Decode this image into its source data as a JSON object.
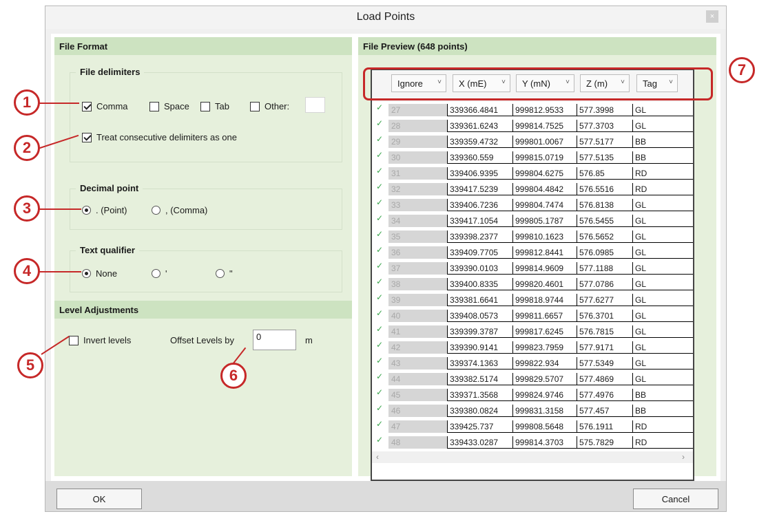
{
  "dialog": {
    "title": "Load Points",
    "close_glyph": "×"
  },
  "file_format": {
    "header": "File Format",
    "delimiters": {
      "label": "File delimiters",
      "comma": {
        "label": "Comma",
        "checked": true
      },
      "space": {
        "label": "Space",
        "checked": false
      },
      "tab": {
        "label": "Tab",
        "checked": false
      },
      "other": {
        "label": "Other:",
        "checked": false,
        "value": ""
      },
      "consecutive": {
        "label": "Treat consecutive delimiters as one",
        "checked": true
      }
    },
    "decimal": {
      "label": "Decimal point",
      "point": {
        "label": ". (Point)",
        "selected": true
      },
      "comma": {
        "label": ", (Comma)",
        "selected": false
      }
    },
    "qualifier": {
      "label": "Text qualifier",
      "none": {
        "label": "None",
        "selected": true
      },
      "single": {
        "label": "'",
        "selected": false
      },
      "double": {
        "label": "\"",
        "selected": false
      }
    }
  },
  "level_adjustments": {
    "header": "Level Adjustments",
    "invert": {
      "label": "Invert levels",
      "checked": false
    },
    "offset": {
      "label": "Offset Levels by",
      "value": "0",
      "unit": "m"
    }
  },
  "preview": {
    "header": "File Preview  (648 points)",
    "columns": [
      "Ignore",
      "X (mE)",
      "Y (mN)",
      "Z (m)",
      "Tag"
    ],
    "rows": [
      [
        "27",
        "339366.4841",
        "999812.9533",
        "577.3998",
        "GL"
      ],
      [
        "28",
        "339361.6243",
        "999814.7525",
        "577.3703",
        "GL"
      ],
      [
        "29",
        "339359.4732",
        "999801.0067",
        "577.5177",
        "BB"
      ],
      [
        "30",
        "339360.559",
        "999815.0719",
        "577.5135",
        "BB"
      ],
      [
        "31",
        "339406.9395",
        "999804.6275",
        "576.85",
        "RD"
      ],
      [
        "32",
        "339417.5239",
        "999804.4842",
        "576.5516",
        "RD"
      ],
      [
        "33",
        "339406.7236",
        "999804.7474",
        "576.8138",
        "GL"
      ],
      [
        "34",
        "339417.1054",
        "999805.1787",
        "576.5455",
        "GL"
      ],
      [
        "35",
        "339398.2377",
        "999810.1623",
        "576.5652",
        "GL"
      ],
      [
        "36",
        "339409.7705",
        "999812.8441",
        "576.0985",
        "GL"
      ],
      [
        "37",
        "339390.0103",
        "999814.9609",
        "577.1188",
        "GL"
      ],
      [
        "38",
        "339400.8335",
        "999820.4601",
        "577.0786",
        "GL"
      ],
      [
        "39",
        "339381.6641",
        "999818.9744",
        "577.6277",
        "GL"
      ],
      [
        "40",
        "339408.0573",
        "999811.6657",
        "576.3701",
        "GL"
      ],
      [
        "41",
        "339399.3787",
        "999817.6245",
        "576.7815",
        "GL"
      ],
      [
        "42",
        "339390.9141",
        "999823.7959",
        "577.9171",
        "GL"
      ],
      [
        "43",
        "339374.1363",
        "999822.934",
        "577.5349",
        "GL"
      ],
      [
        "44",
        "339382.5174",
        "999829.5707",
        "577.4869",
        "GL"
      ],
      [
        "45",
        "339371.3568",
        "999824.9746",
        "577.4976",
        "BB"
      ],
      [
        "46",
        "339380.0824",
        "999831.3158",
        "577.457",
        "BB"
      ],
      [
        "47",
        "339425.737",
        "999808.5648",
        "576.1911",
        "RD"
      ],
      [
        "48",
        "339433.0287",
        "999814.3703",
        "575.7829",
        "RD"
      ]
    ]
  },
  "buttons": {
    "ok": "OK",
    "cancel": "Cancel"
  },
  "callouts": [
    "1",
    "2",
    "3",
    "4",
    "5",
    "6",
    "7"
  ],
  "colors": {
    "accent_red": "#c62828",
    "panel_green": "#e6f0dc",
    "header_green": "#cde3c1",
    "check_green": "#37a44a"
  }
}
